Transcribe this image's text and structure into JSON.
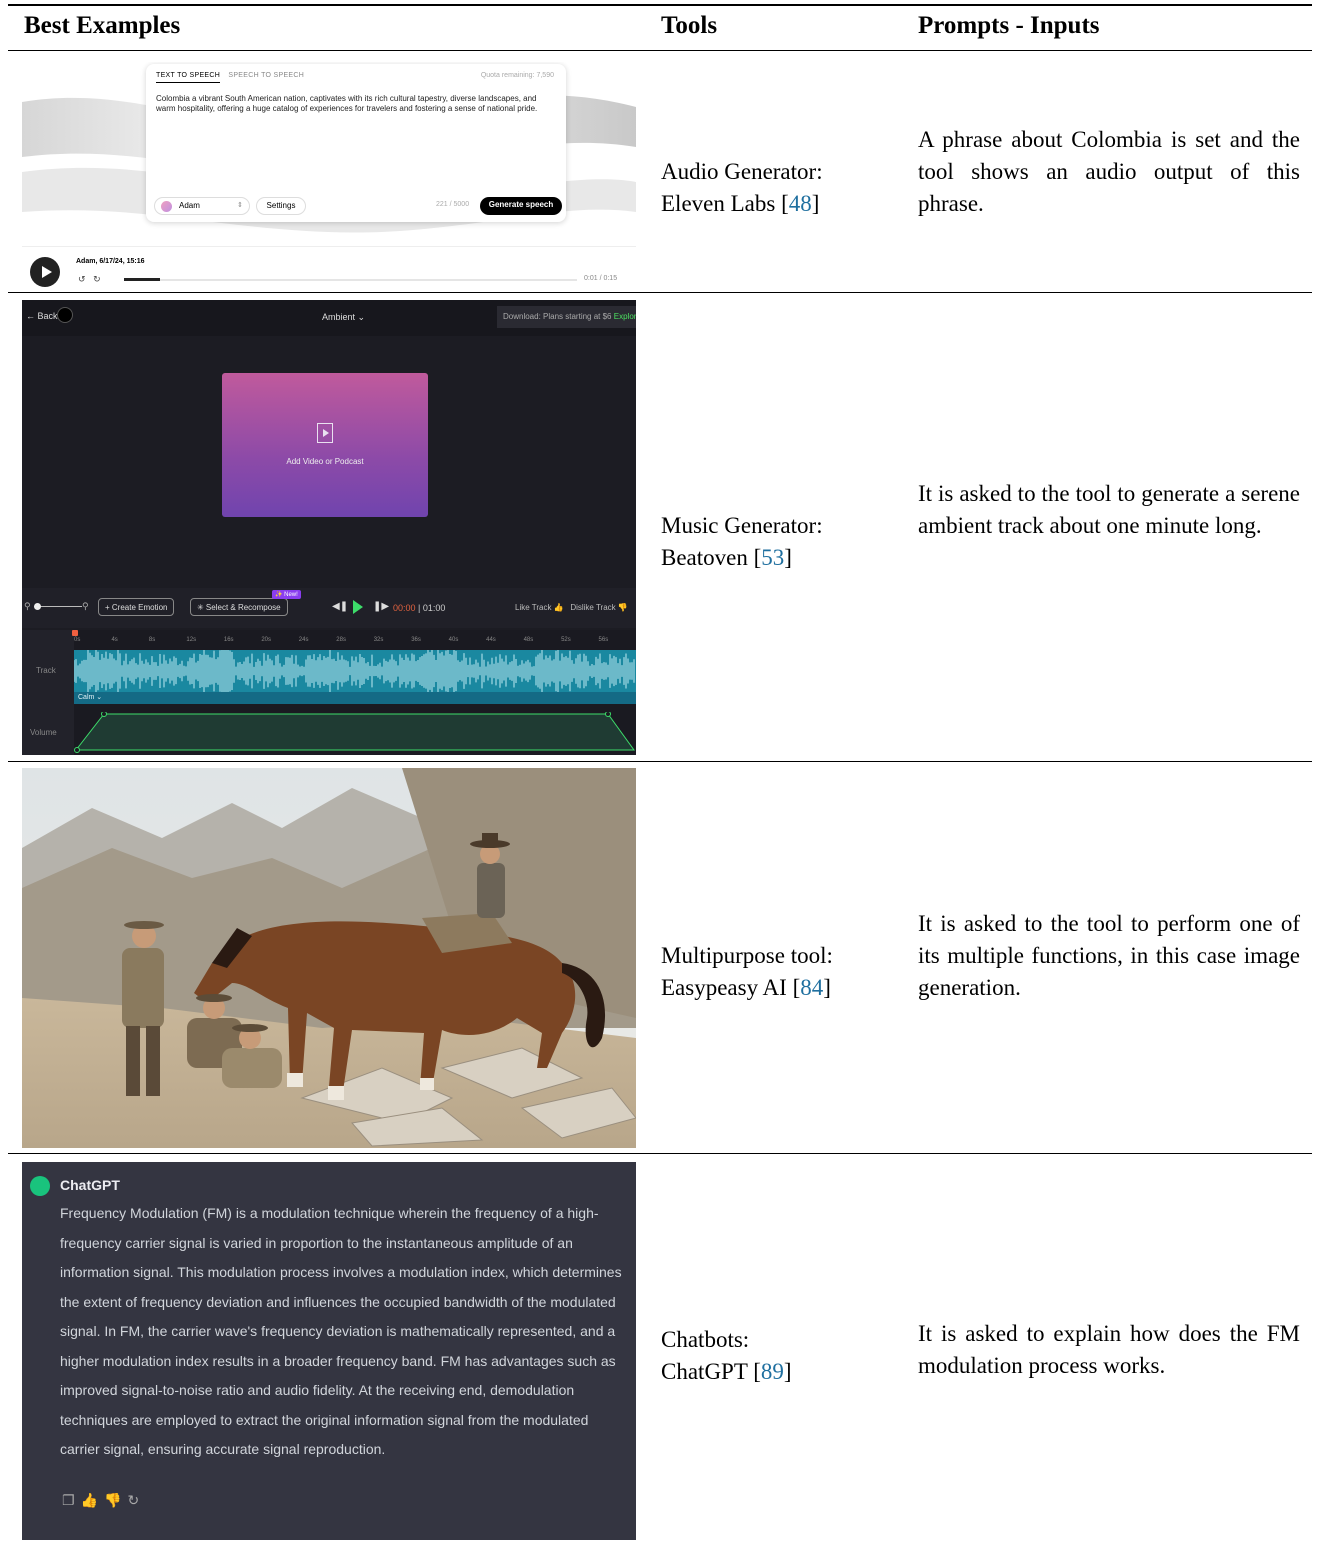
{
  "table": {
    "headers": {
      "examples": "Best Examples",
      "tools": "Tools",
      "prompts": "Prompts - Inputs"
    },
    "rows": [
      {
        "tool_name": "Audio Generator:",
        "tool_product": "Eleven Labs",
        "citation": "48",
        "prompt": "A phrase about Colombia is set and the tool shows an audio output of this phrase."
      },
      {
        "tool_name": "Music Generator:",
        "tool_product": "Beatoven",
        "citation": "53",
        "prompt": "It is asked to the tool to generate a serene ambient track about one minute long."
      },
      {
        "tool_name": "Multipurpose tool:",
        "tool_product": "Easypeasy AI",
        "citation": "84",
        "prompt": "It is asked to the tool to perform one of its multiple functions, in this case image generation."
      },
      {
        "tool_name": "Chatbots:",
        "tool_product": "ChatGPT",
        "citation": "89",
        "prompt": "It is asked to explain how does the FM modulation process works."
      }
    ]
  },
  "elevenlabs": {
    "tab_tts": "TEXT TO SPEECH",
    "tab_sts": "SPEECH TO SPEECH",
    "quota": "Quota remaining: 7,590",
    "text": "Colombia a vibrant South American nation, captivates with its rich cultural tapestry, diverse landscapes, and warm hospitality, offering a huge catalog of experiences for travelers and fostering a sense of national pride.",
    "voice": "Adam",
    "settings": "Settings",
    "char_count": "221 / 5000",
    "generate": "Generate speech",
    "player_title": "Adam, 6/17/24, 15:16",
    "player_time": "0:01  /  0:15",
    "progress": 0.08
  },
  "beatoven": {
    "back": "Back",
    "mode": "Ambient ⌄",
    "download_text": "Download: Plans starting at $6",
    "download_link": "Explore",
    "media_label": "Add Video or Podcast",
    "create_emotion": "+ Create Emotion",
    "select_recompose": "✳ Select & Recompose",
    "new_tag": "✨ New!",
    "time_current": "00:00",
    "time_total": "| 01:00",
    "like": "Like Track 👍",
    "dislike": "Dislike Track 👎",
    "track_label": "Track",
    "volume_label": "Volume",
    "section_label": "Calm ⌄",
    "ticks": [
      "0s",
      "4s",
      "8s",
      "12s",
      "16s",
      "20s",
      "24s",
      "28s",
      "32s",
      "36s",
      "40s",
      "44s",
      "48s",
      "52s",
      "56s"
    ]
  },
  "chatgpt": {
    "name": "ChatGPT",
    "message": "Frequency Modulation (FM) is a modulation technique wherein the frequency of a high-frequency carrier signal is varied in proportion to the instantaneous amplitude of an information signal. This modulation process involves a modulation index, which determines the extent of frequency deviation and influences the occupied bandwidth of the modulated signal. In FM, the carrier wave's frequency deviation is mathematically represented, and a higher modulation index results in a broader frequency band. FM has advantages such as improved signal-to-noise ratio and audio fidelity. At the receiving end, demodulation techniques are employed to extract the original information signal from the modulated carrier signal, ensuring accurate signal reproduction."
  },
  "icons": {
    "chatgpt_actions": [
      "copy-icon",
      "thumbs-up-icon",
      "thumbs-down-icon",
      "regenerate-icon"
    ]
  }
}
